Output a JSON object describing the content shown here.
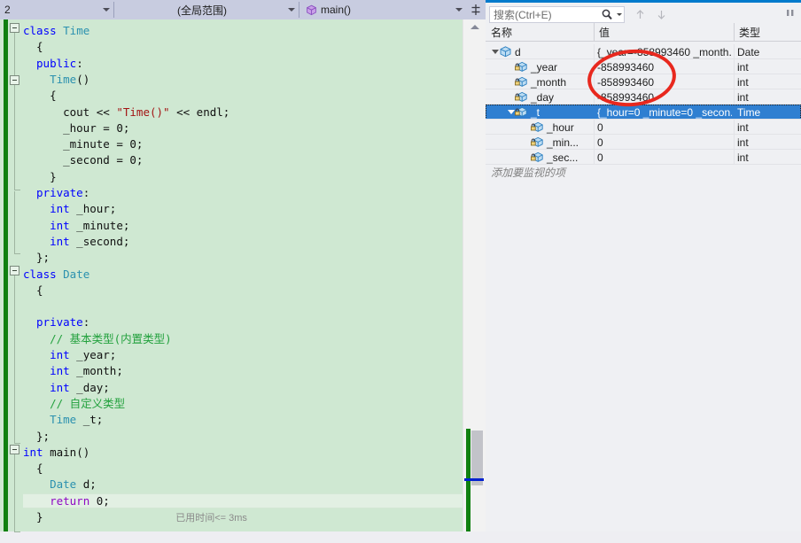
{
  "editor": {
    "navbar": {
      "scope_document": "2",
      "scope_global": "(全局范围)",
      "member": "main()",
      "member_icon": "method-cube-icon",
      "split_icon": "split-window-icon"
    },
    "code_lines": [
      {
        "indent": 0,
        "tokens": [
          {
            "t": "class ",
            "c": "kw"
          },
          {
            "t": "Time",
            "c": "type"
          }
        ]
      },
      {
        "indent": 1,
        "tokens": [
          {
            "t": "{",
            "c": "pln"
          }
        ]
      },
      {
        "indent": 1,
        "tokens": [
          {
            "t": "public",
            "c": "kw"
          },
          {
            "t": ":",
            "c": "pln"
          }
        ]
      },
      {
        "indent": 2,
        "tokens": [
          {
            "t": "Time",
            "c": "type"
          },
          {
            "t": "()",
            "c": "pln"
          }
        ]
      },
      {
        "indent": 2,
        "tokens": [
          {
            "t": "{",
            "c": "pln"
          }
        ]
      },
      {
        "indent": 3,
        "tokens": [
          {
            "t": "cout ",
            "c": "pln"
          },
          {
            "t": "<<",
            "c": "pln"
          },
          {
            "t": " \"Time()\" ",
            "c": "str"
          },
          {
            "t": "<<",
            "c": "pln"
          },
          {
            "t": " endl;",
            "c": "pln"
          }
        ]
      },
      {
        "indent": 3,
        "tokens": [
          {
            "t": "_hour = 0;",
            "c": "pln"
          }
        ]
      },
      {
        "indent": 3,
        "tokens": [
          {
            "t": "_minute = 0;",
            "c": "pln"
          }
        ]
      },
      {
        "indent": 3,
        "tokens": [
          {
            "t": "_second = 0;",
            "c": "pln"
          }
        ]
      },
      {
        "indent": 2,
        "tokens": [
          {
            "t": "}",
            "c": "pln"
          }
        ]
      },
      {
        "indent": 1,
        "tokens": [
          {
            "t": "private",
            "c": "kw"
          },
          {
            "t": ":",
            "c": "pln"
          }
        ]
      },
      {
        "indent": 2,
        "tokens": [
          {
            "t": "int",
            "c": "kw"
          },
          {
            "t": " _hour;",
            "c": "pln"
          }
        ]
      },
      {
        "indent": 2,
        "tokens": [
          {
            "t": "int",
            "c": "kw"
          },
          {
            "t": " _minute;",
            "c": "pln"
          }
        ]
      },
      {
        "indent": 2,
        "tokens": [
          {
            "t": "int",
            "c": "kw"
          },
          {
            "t": " _second;",
            "c": "pln"
          }
        ]
      },
      {
        "indent": 1,
        "tokens": [
          {
            "t": "};",
            "c": "pln"
          }
        ]
      },
      {
        "indent": 0,
        "tokens": [
          {
            "t": "class ",
            "c": "kw"
          },
          {
            "t": "Date",
            "c": "type"
          }
        ]
      },
      {
        "indent": 1,
        "tokens": [
          {
            "t": "{",
            "c": "pln"
          }
        ]
      },
      {
        "indent": 1,
        "tokens": []
      },
      {
        "indent": 1,
        "tokens": [
          {
            "t": "private",
            "c": "kw"
          },
          {
            "t": ":",
            "c": "pln"
          }
        ]
      },
      {
        "indent": 2,
        "tokens": [
          {
            "t": "// 基本类型(内置类型)",
            "c": "cmt"
          }
        ]
      },
      {
        "indent": 2,
        "tokens": [
          {
            "t": "int",
            "c": "kw"
          },
          {
            "t": " _year;",
            "c": "pln"
          }
        ]
      },
      {
        "indent": 2,
        "tokens": [
          {
            "t": "int",
            "c": "kw"
          },
          {
            "t": " _month;",
            "c": "pln"
          }
        ]
      },
      {
        "indent": 2,
        "tokens": [
          {
            "t": "int",
            "c": "kw"
          },
          {
            "t": " _day;",
            "c": "pln"
          }
        ]
      },
      {
        "indent": 2,
        "tokens": [
          {
            "t": "// 自定义类型",
            "c": "cmt"
          }
        ]
      },
      {
        "indent": 2,
        "tokens": [
          {
            "t": "Time",
            "c": "type"
          },
          {
            "t": " _t;",
            "c": "pln"
          }
        ]
      },
      {
        "indent": 1,
        "tokens": [
          {
            "t": "};",
            "c": "pln"
          }
        ]
      },
      {
        "indent": 0,
        "tokens": [
          {
            "t": "int",
            "c": "kw"
          },
          {
            "t": " ",
            "c": "pln"
          },
          {
            "t": "main",
            "c": "pln"
          },
          {
            "t": "()",
            "c": "pln"
          }
        ]
      },
      {
        "indent": 1,
        "tokens": [
          {
            "t": "{",
            "c": "pln"
          }
        ]
      },
      {
        "indent": 2,
        "tokens": [
          {
            "t": "Date",
            "c": "type"
          },
          {
            "t": " d;",
            "c": "pln"
          }
        ]
      },
      {
        "indent": 2,
        "tokens": [
          {
            "t": "return",
            "c": "kw2"
          },
          {
            "t": " 0;",
            "c": "pln"
          }
        ]
      },
      {
        "indent": 1,
        "tokens": [
          {
            "t": "}",
            "c": "pln"
          }
        ]
      }
    ],
    "inline_diagnostic": {
      "label": "已用时间",
      "value": "<= 3ms"
    },
    "scrollbar": {
      "up_arrow_icon": "scroll-up-arrow-icon",
      "caret_marker_color": "#0020d0",
      "change_marker_color": "#108010"
    }
  },
  "watch": {
    "search": {
      "placeholder": "搜索(Ctrl+E)",
      "value": "",
      "search_icon": "magnifier-icon",
      "dropdown_icon": "chevron-down-icon",
      "prev_icon": "arrow-up-icon",
      "next_icon": "arrow-down-icon",
      "grip_icon": "pane-grip-icon"
    },
    "columns": [
      "名称",
      "值",
      "类型"
    ],
    "rows": [
      {
        "depth": 0,
        "expander": "expanded",
        "icon": "object-cube-icon",
        "name": "d",
        "value": "{_year=-858993460 _month...",
        "type": "Date",
        "selected": false
      },
      {
        "depth": 1,
        "expander": "none",
        "icon": "private-field-icon",
        "name": "_year",
        "value": "-858993460",
        "type": "int",
        "selected": false
      },
      {
        "depth": 1,
        "expander": "none",
        "icon": "private-field-icon",
        "name": "_month",
        "value": "-858993460",
        "type": "int",
        "selected": false
      },
      {
        "depth": 1,
        "expander": "none",
        "icon": "private-field-icon",
        "name": "_day",
        "value": "-858993460",
        "type": "int",
        "selected": false
      },
      {
        "depth": 1,
        "expander": "expanded",
        "icon": "private-field-icon",
        "name": "_t",
        "value": "{_hour=0 _minute=0 _secon...",
        "type": "Time",
        "selected": true
      },
      {
        "depth": 2,
        "expander": "none",
        "icon": "private-field-icon",
        "name": "_hour",
        "value": "0",
        "type": "int",
        "selected": false
      },
      {
        "depth": 2,
        "expander": "none",
        "icon": "private-field-icon",
        "name": "_min...",
        "value": "0",
        "type": "int",
        "selected": false
      },
      {
        "depth": 2,
        "expander": "none",
        "icon": "private-field-icon",
        "name": "_sec...",
        "value": "0",
        "type": "int",
        "selected": false
      }
    ],
    "add_item_placeholder": "添加要监视的项"
  },
  "annotation": {
    "shape": "red-ellipse",
    "color": "#e8281e"
  }
}
